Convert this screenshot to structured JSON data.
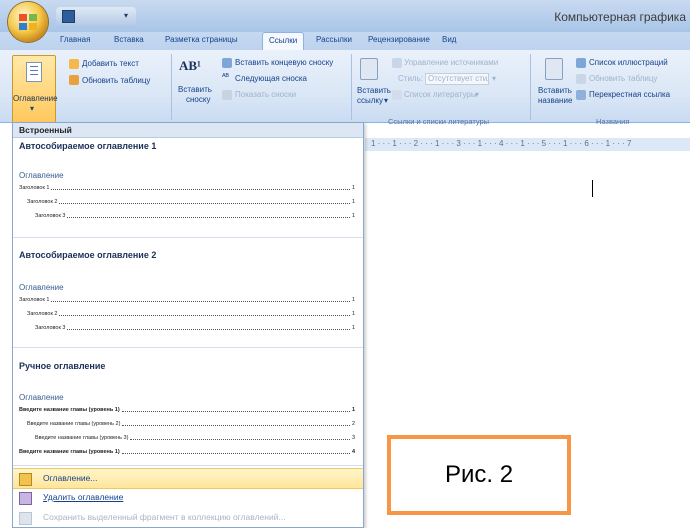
{
  "window": {
    "title": "Компьютерная графика"
  },
  "tabs": [
    {
      "label": "Главная",
      "active": false
    },
    {
      "label": "Вставка",
      "active": false
    },
    {
      "label": "Разметка страницы",
      "active": false
    },
    {
      "label": "Ссылки",
      "active": true
    },
    {
      "label": "Рассылки",
      "active": false
    },
    {
      "label": "Рецензирование",
      "active": false
    },
    {
      "label": "Вид",
      "active": false
    }
  ],
  "ribbon": {
    "toc_group": {
      "big_button": "Оглавление",
      "add_text": "Добавить текст",
      "update_table": "Обновить таблицу"
    },
    "footnotes_group": {
      "insert_footnote_line1": "Вставить",
      "insert_footnote_line2": "сноску",
      "insert_endnote": "Вставить концевую сноску",
      "next_footnote": "Следующая сноска",
      "show_notes": "Показать сноски"
    },
    "citations_group": {
      "insert_citation_line1": "Вставить",
      "insert_citation_line2": "ссылку",
      "manage_sources": "Управление источниками",
      "style_label": "Стиль:",
      "style_value": "Отсутствует стил",
      "bibliography": "Список литературы",
      "label": "Ссылки и списки литературы"
    },
    "captions_group": {
      "insert_caption_line1": "Вставить",
      "insert_caption_line2": "название",
      "table_of_figures": "Список иллюстраций",
      "update_table": "Обновить таблицу",
      "cross_reference": "Перекрестная ссылка",
      "label": "Названия"
    }
  },
  "ruler": {
    "text": "1 · · · 1 · · · 2 · · · 1 · · · 3 · · · 1 · · · 4 · · · 1 · · · 5 · · · 1 · · · 6 · · · 1 · · · 7"
  },
  "gallery": {
    "header": "Встроенный",
    "sections": [
      {
        "title": "Автособираемое оглавление 1",
        "heading": "Оглавление",
        "entries": [
          {
            "text": "Заголовок 1",
            "page": "1"
          },
          {
            "text": "Заголовок 2",
            "page": "1"
          },
          {
            "text": "Заголовок 3",
            "page": "1"
          }
        ]
      },
      {
        "title": "Автособираемое оглавление 2",
        "heading": "Оглавление",
        "entries": [
          {
            "text": "Заголовок 1",
            "page": "1"
          },
          {
            "text": "Заголовок 2",
            "page": "1"
          },
          {
            "text": "Заголовок 3",
            "page": "1"
          }
        ]
      },
      {
        "title": "Ручное оглавление",
        "heading": "Оглавление",
        "entries": [
          {
            "text": "Введите название главы (уровень 1)",
            "page": "1"
          },
          {
            "text": "Введите название главы (уровень 2)",
            "page": "2"
          },
          {
            "text": "Введите название главы (уровень 3)",
            "page": "3"
          },
          {
            "text": "Введите название главы (уровень 1)",
            "page": "4"
          }
        ]
      }
    ],
    "menu": [
      {
        "label": "Оглавление..."
      },
      {
        "label": "Удалить оглавление"
      },
      {
        "label": "Сохранить выделенный фрагмент в коллекцию оглавлений..."
      }
    ]
  },
  "figure_caption": "Рис. 2",
  "colors": {
    "ribbon_text": "#15428b",
    "highlight": "#ffe59a",
    "fig_border": "#f79646"
  }
}
